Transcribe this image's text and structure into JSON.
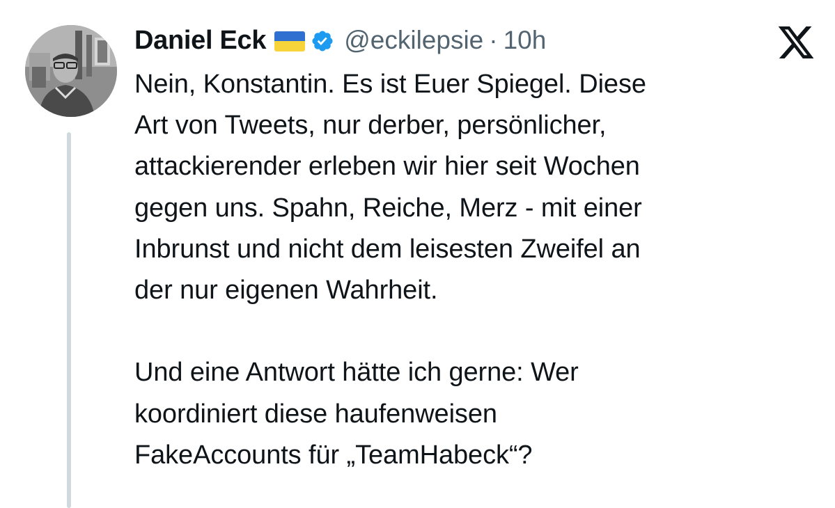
{
  "tweet": {
    "display_name": "Daniel Eck",
    "flag_icon": "ukraine-flag-icon",
    "verified_icon": "verified-badge-icon",
    "handle": "@eckilepsie",
    "separator": "·",
    "time": "10h",
    "platform_icon": "x-logo-icon",
    "text_lines": [
      "Nein, Konstantin. Es ist Euer Spiegel. Diese",
      "Art von Tweets, nur derber, persönlicher,",
      "attackierender erleben wir hier seit Wochen",
      "gegen uns. Spahn, Reiche, Merz - mit einer",
      "Inbrunst und nicht dem leisesten Zweifel an",
      "der nur eigenen Wahrheit.",
      "",
      "Und eine Antwort hätte ich gerne: Wer",
      "koordiniert diese haufenweisen",
      "FakeAccounts für „TeamHabeck“?"
    ]
  },
  "colors": {
    "text": "#0f1419",
    "secondary": "#536471",
    "verified": "#1d9bf0",
    "thread_line": "#cfd9de",
    "flag_blue": "#2f6fd0",
    "flag_yellow": "#f7d43a"
  }
}
